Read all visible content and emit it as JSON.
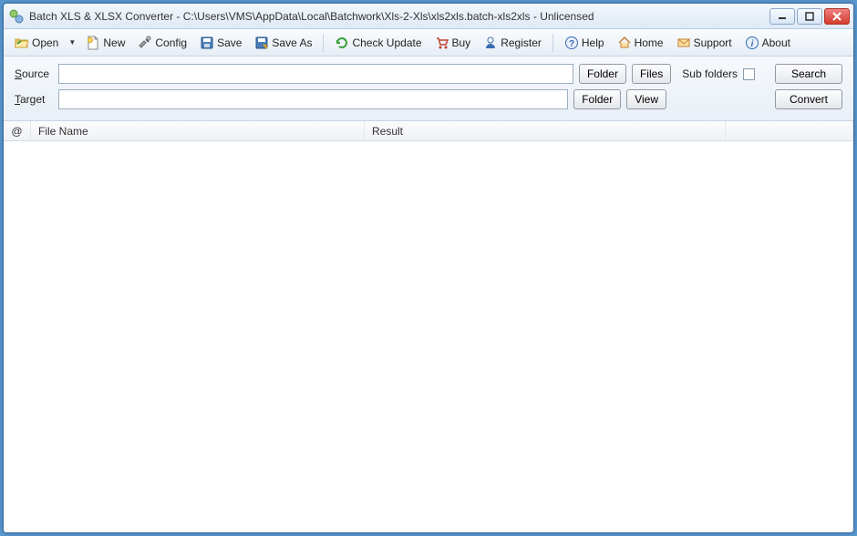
{
  "titlebar": {
    "title": "Batch XLS & XLSX Converter - C:\\Users\\VMS\\AppData\\Local\\Batchwork\\Xls-2-Xls\\xls2xls.batch-xls2xls - Unlicensed"
  },
  "toolbar": {
    "open": "Open",
    "new": "New",
    "config": "Config",
    "save": "Save",
    "save_as": "Save As",
    "check_update": "Check Update",
    "buy": "Buy",
    "register": "Register",
    "help": "Help",
    "home": "Home",
    "support": "Support",
    "about": "About"
  },
  "form": {
    "source_label": "Source",
    "target_label": "Target",
    "source_value": "",
    "target_value": "",
    "folder_btn": "Folder",
    "files_btn": "Files",
    "view_btn": "View",
    "sub_folders_label": "Sub folders",
    "sub_folders_checked": false,
    "search_btn": "Search",
    "convert_btn": "Convert"
  },
  "table": {
    "col_at": "@",
    "col_filename": "File Name",
    "col_result": "Result",
    "rows": []
  }
}
